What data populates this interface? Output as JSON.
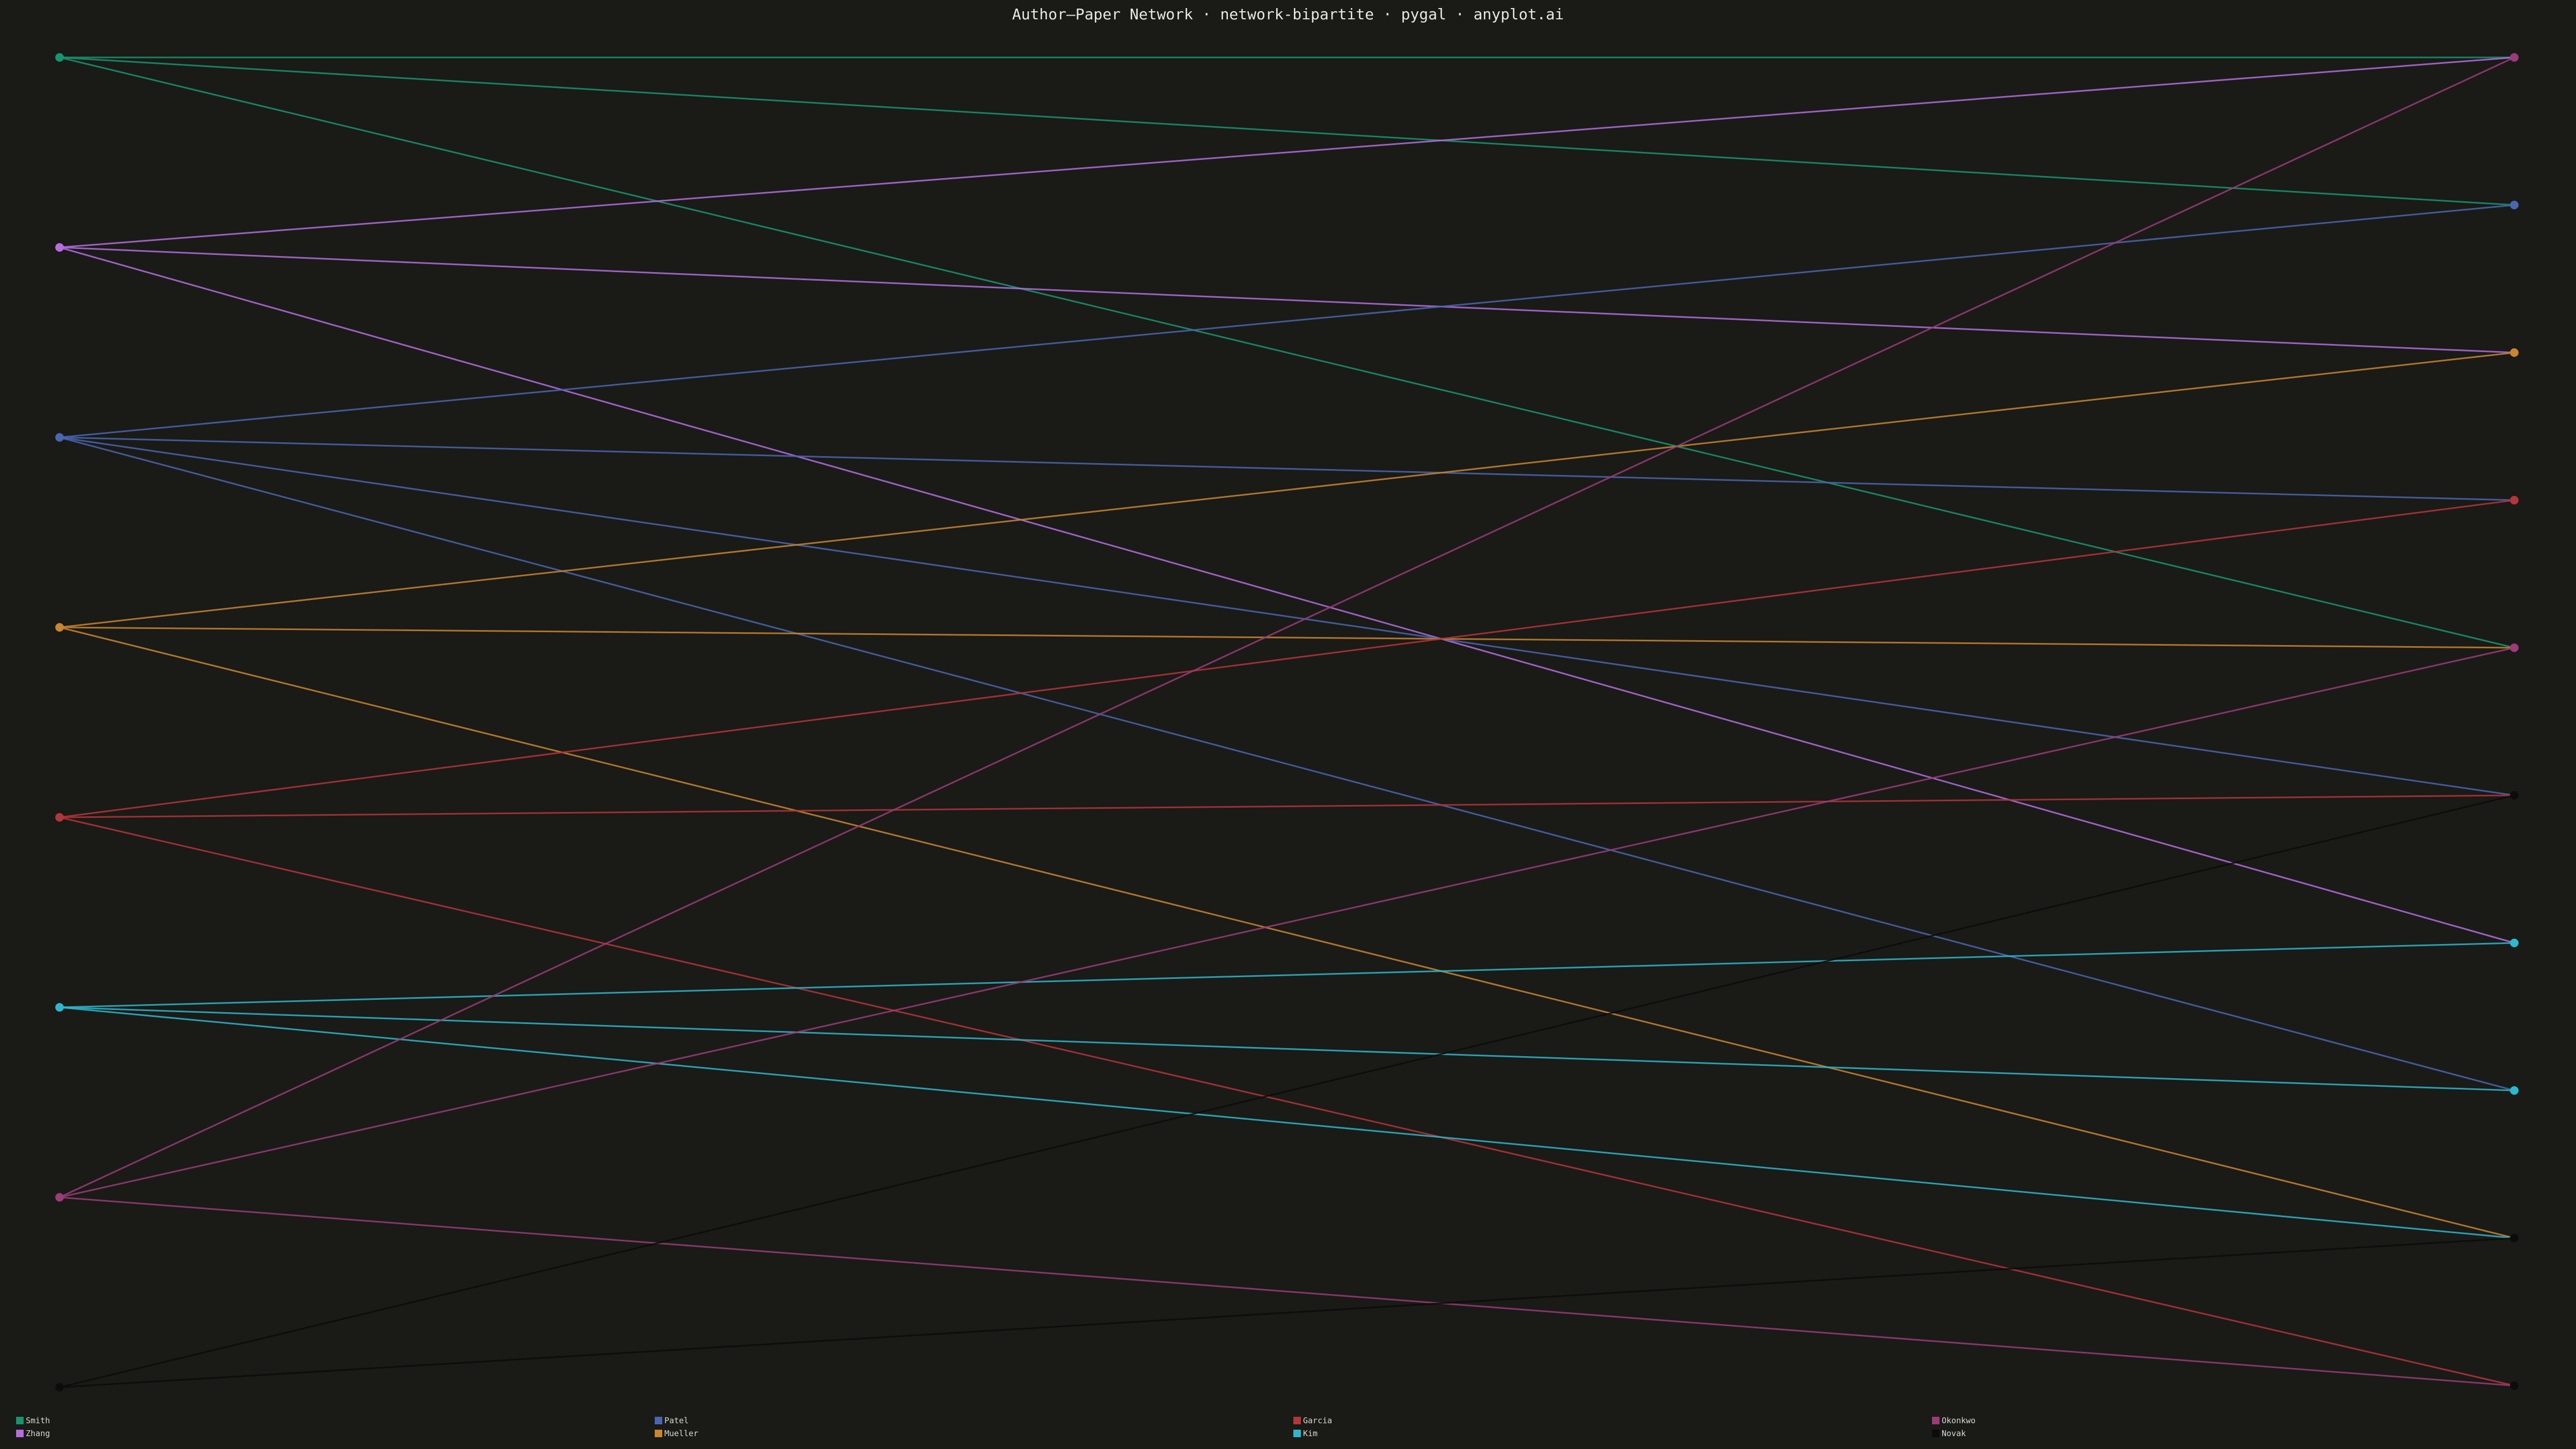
{
  "title": "Author–Paper Network · network-bipartite · pygal · anyplot.ai",
  "colors": {
    "background": "#1a1a17",
    "text": "#e8e8e0"
  },
  "authors": [
    {
      "name": "Smith",
      "color": "#17956f"
    },
    {
      "name": "Zhang",
      "color": "#b56de0"
    },
    {
      "name": "Patel",
      "color": "#4a66b0"
    },
    {
      "name": "Mueller",
      "color": "#c98530"
    },
    {
      "name": "Garcia",
      "color": "#b4353a"
    },
    {
      "name": "Kim",
      "color": "#2db7cc"
    },
    {
      "name": "Okonkwo",
      "color": "#9a3c78"
    },
    {
      "name": "Novak",
      "color": "#0c0c0a"
    }
  ],
  "paper_count": 10,
  "paper_colors": [
    "#9a3c78",
    "#4a66b0",
    "#c98530",
    "#b4353a",
    "#9a3c78",
    "#0c0c0a",
    "#2db7cc",
    "#2db7cc",
    "#0c0c0a",
    "#0c0c0a"
  ],
  "edges": [
    {
      "author": 0,
      "paper": 0
    },
    {
      "author": 0,
      "paper": 1
    },
    {
      "author": 0,
      "paper": 4
    },
    {
      "author": 1,
      "paper": 0
    },
    {
      "author": 1,
      "paper": 2
    },
    {
      "author": 1,
      "paper": 6
    },
    {
      "author": 2,
      "paper": 1
    },
    {
      "author": 2,
      "paper": 3
    },
    {
      "author": 2,
      "paper": 5
    },
    {
      "author": 2,
      "paper": 7
    },
    {
      "author": 3,
      "paper": 2
    },
    {
      "author": 3,
      "paper": 4
    },
    {
      "author": 3,
      "paper": 8
    },
    {
      "author": 4,
      "paper": 3
    },
    {
      "author": 4,
      "paper": 5
    },
    {
      "author": 4,
      "paper": 9
    },
    {
      "author": 5,
      "paper": 6
    },
    {
      "author": 5,
      "paper": 7
    },
    {
      "author": 5,
      "paper": 8
    },
    {
      "author": 6,
      "paper": 0
    },
    {
      "author": 6,
      "paper": 4
    },
    {
      "author": 6,
      "paper": 9
    },
    {
      "author": 7,
      "paper": 5
    },
    {
      "author": 7,
      "paper": 8
    }
  ],
  "legend_order": [
    0,
    1,
    2,
    3,
    4,
    5,
    6,
    7
  ]
}
